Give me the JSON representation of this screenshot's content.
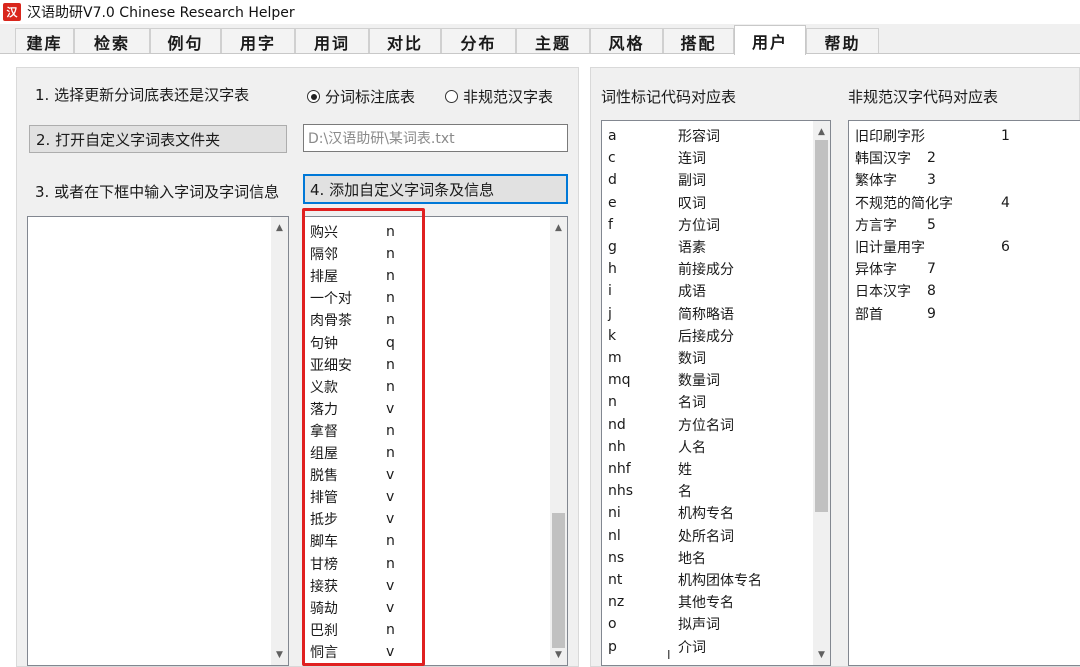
{
  "window": {
    "title": "汉语助研V7.0  Chinese Research Helper",
    "icon_glyph": "汉"
  },
  "tabs": [
    {
      "label": "建库"
    },
    {
      "label": "检索"
    },
    {
      "label": "例句"
    },
    {
      "label": "用字"
    },
    {
      "label": "用词"
    },
    {
      "label": "对比"
    },
    {
      "label": "分布"
    },
    {
      "label": "主题"
    },
    {
      "label": "风格"
    },
    {
      "label": "搭配"
    },
    {
      "label": "用户",
      "active": true
    },
    {
      "label": "帮助"
    }
  ],
  "left": {
    "step1_label": "1. 选择更新分词底表还是汉字表",
    "radio_option1": "分词标注底表",
    "radio_option2": "非规范汉字表",
    "step2_button": "2. 打开自定义字词表文件夹",
    "file_path_value": "D:\\汉语助研\\某词表.txt",
    "step3_label": "3. 或者在下框中输入字词及字词信息",
    "step4_button": "4. 添加自定义字词条及信息",
    "entries": [
      {
        "word": "购兴",
        "tag": "n"
      },
      {
        "word": "隔邻",
        "tag": "n"
      },
      {
        "word": "排屋",
        "tag": "n"
      },
      {
        "word": "一个对",
        "tag": "n"
      },
      {
        "word": "肉骨茶",
        "tag": "n"
      },
      {
        "word": "句钟",
        "tag": "q"
      },
      {
        "word": "亚细安",
        "tag": "n"
      },
      {
        "word": "义款",
        "tag": "n"
      },
      {
        "word": "落力",
        "tag": "v"
      },
      {
        "word": "拿督",
        "tag": "n"
      },
      {
        "word": "组屋",
        "tag": "n"
      },
      {
        "word": "脱售",
        "tag": "v"
      },
      {
        "word": "排管",
        "tag": "v"
      },
      {
        "word": "抵步",
        "tag": "v"
      },
      {
        "word": "脚车",
        "tag": "n"
      },
      {
        "word": "甘榜",
        "tag": "n"
      },
      {
        "word": "接获",
        "tag": "v"
      },
      {
        "word": "骑劫",
        "tag": "v"
      },
      {
        "word": "巴刹",
        "tag": "n"
      },
      {
        "word": "恫言",
        "tag": "v"
      }
    ]
  },
  "pos_table": {
    "title": "词性标记代码对应表",
    "rows": [
      {
        "code": "a",
        "name": "形容词"
      },
      {
        "code": "c",
        "name": "连词"
      },
      {
        "code": "d",
        "name": "副词"
      },
      {
        "code": "e",
        "name": "叹词"
      },
      {
        "code": "f",
        "name": "方位词"
      },
      {
        "code": "g",
        "name": "语素"
      },
      {
        "code": "h",
        "name": "前接成分"
      },
      {
        "code": "i",
        "name": "成语"
      },
      {
        "code": "j",
        "name": "简称略语"
      },
      {
        "code": "k",
        "name": "后接成分"
      },
      {
        "code": "m",
        "name": "数词"
      },
      {
        "code": "mq",
        "name": "数量词"
      },
      {
        "code": "n",
        "name": "名词"
      },
      {
        "code": "nd",
        "name": "方位名词"
      },
      {
        "code": "nh",
        "name": "人名"
      },
      {
        "code": "nhf",
        "name": "姓"
      },
      {
        "code": "nhs",
        "name": "名"
      },
      {
        "code": "ni",
        "name": "机构专名"
      },
      {
        "code": "nl",
        "name": "处所名词"
      },
      {
        "code": "ns",
        "name": "地名"
      },
      {
        "code": "nt",
        "name": "机构团体专名"
      },
      {
        "code": "nz",
        "name": "其他专名"
      },
      {
        "code": "o",
        "name": "拟声词"
      },
      {
        "code": "p",
        "name": "介词"
      }
    ]
  },
  "nonstd_table": {
    "title": "非规范汉字代码对应表",
    "rows": [
      {
        "name": "旧印刷字形",
        "code": "1"
      },
      {
        "name": "韩国汉字",
        "code": "2"
      },
      {
        "name": "繁体字",
        "code": "3"
      },
      {
        "name": "不规范的简化字",
        "code": "4"
      },
      {
        "name": "方言字",
        "code": "5"
      },
      {
        "name": "旧计量用字",
        "code": "6"
      },
      {
        "name": "异体字",
        "code": "7"
      },
      {
        "name": "日本汉字",
        "code": "8"
      },
      {
        "name": "部首",
        "code": "9"
      }
    ]
  },
  "colors": {
    "highlight": "#e02020",
    "focus": "#0078d7"
  }
}
